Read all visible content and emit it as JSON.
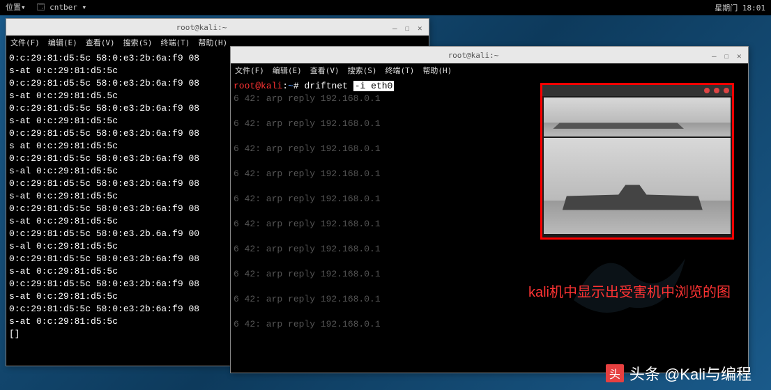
{
  "panel": {
    "left_items": [
      "位置▾",
      "🗔 cntber ▾"
    ],
    "right": "星期门 18:01"
  },
  "term1": {
    "title": "root@kali:~",
    "menus": [
      "文件(F)",
      "编辑(E)",
      "查看(V)",
      "搜索(S)",
      "终端(T)",
      "帮助(H)"
    ],
    "lines": [
      "0:c:29:81:d5:5c 58:0:e3:2b:6a:f9 08",
      "s-at 0:c:29:81:d5:5c",
      "0:c:29:81:d5:5c 58:0:e3:2b:6a:f9 08",
      "s-at 0:c:29:81:d5.5c",
      "0:c:29:81:d5:5c 58:0:e3:2b:6a:f9 08",
      "s-at 0:c:29:81:d5:5c",
      "0:c:29:81:d5:5c 58:0:e3:2b:6a:f9 08",
      "s at 0:c:29:81:d5:5c",
      "0:c:29:81:d5:5c 58:0:e3:2b:6a:f9 08",
      "s-al 0:c:29:81:d5:5c",
      "0:c:29:81:d5:5c 58:0:e3:2b:6a:f9 08",
      "s-at 0:c:29:81:d5:5c",
      "0:c:29:81:d5:5c 58:0:e3:2b:6a:f9 08",
      "s-at 0:c:29:81:d5:5c",
      "0:c:29:81:d5:5c 58:0:e3.2b.6a.f9 00",
      "s-al 0:c:29:81:d5:5c",
      "0:c:29:81:d5:5c 58:0:e3:2b:6a:f9 08",
      "s-at 0:c:29:81:d5:5c",
      "0:c:29:81:d5:5c 58:0:e3:2b:6a:f9 08",
      "s-at 0:c:29:81:d5:5c",
      "0:c:29:81:d5:5c 58:0:e3:2b:6a:f9 08",
      "s-at 0:c:29:81:d5:5c",
      "[]"
    ]
  },
  "term2": {
    "title": "root@kali:~",
    "menus": [
      "文件(F)",
      "编辑(E)",
      "查看(V)",
      "搜索(S)",
      "终端(T)",
      "帮助(H)"
    ],
    "prompt_user": "root",
    "prompt_host": "kali",
    "prompt_path": "~",
    "command": "driftnet",
    "args": "-i eth0",
    "faded_lines": [
      "6 42: arp reply 192.168.0.1",
      "6 42: arp reply 192.168.0.1",
      "6 42: arp reply 192.168.0.1",
      "6 42: arp reply 192.168.0.1",
      "6 42: arp reply 192.168.0.1",
      "6 42: arp reply 192.168.0.1",
      "6 42: arp reply 192.168.0.1",
      "6 42: arp reply 192.168.0.1",
      "6 42: arp reply 192.168.0.1",
      "6 42: arp reply 192.168.0.1"
    ],
    "annotation": "kali机中显示出受害机中浏览的图"
  },
  "watermark": {
    "icon": "头",
    "text": "头条 @Kali与编程"
  }
}
